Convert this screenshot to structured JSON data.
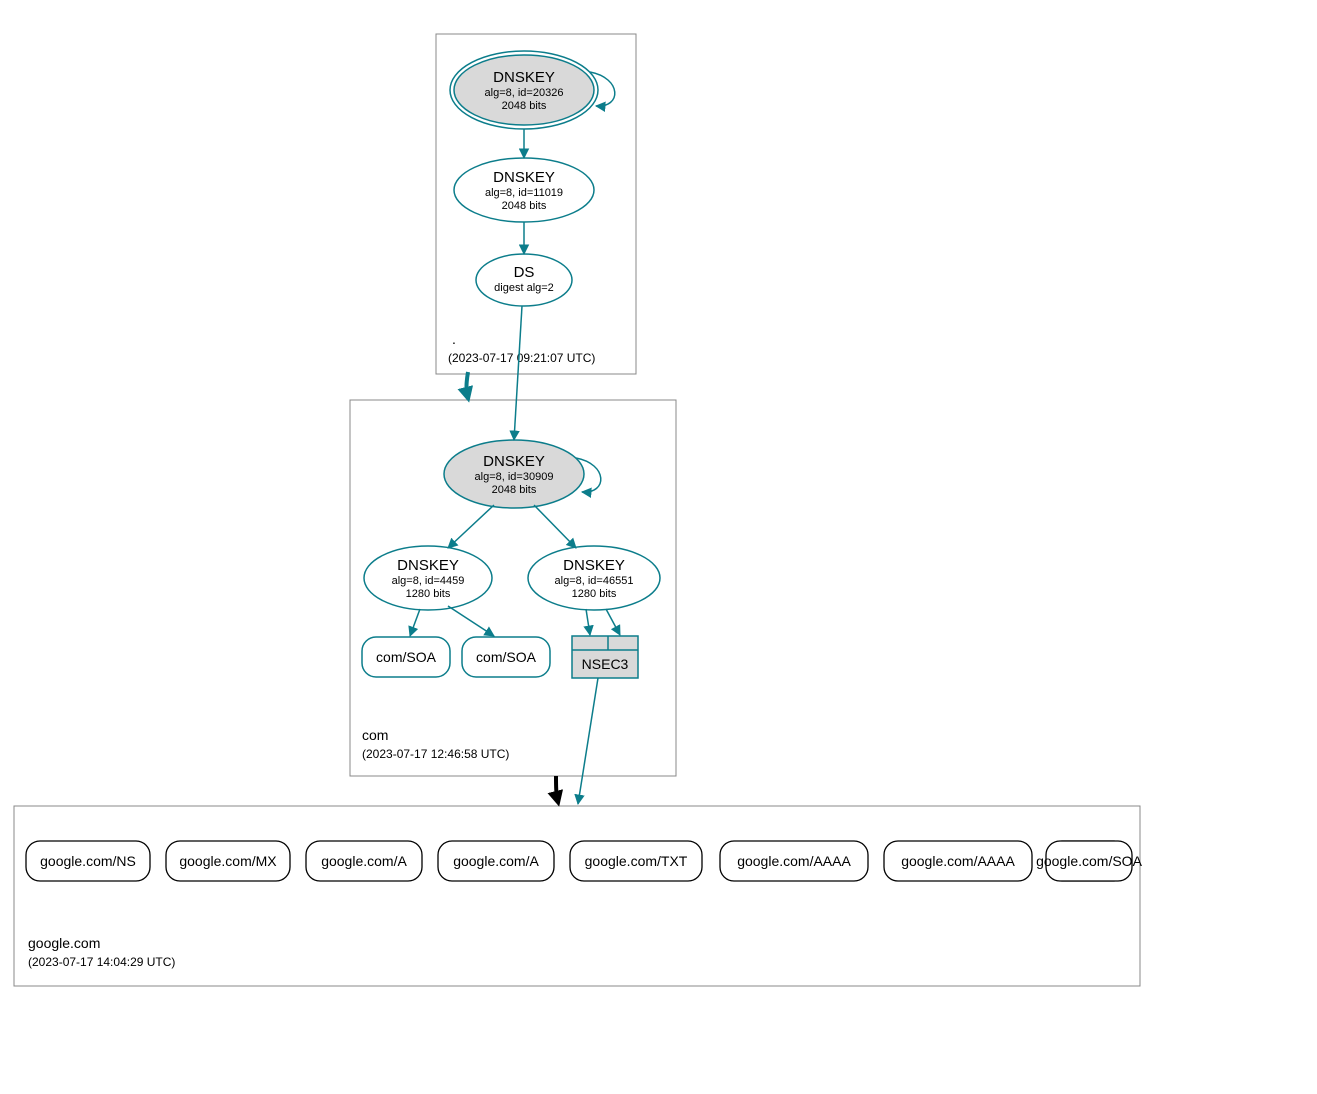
{
  "colors": {
    "teal": "#0c7d8b",
    "grey_fill": "#d9d9d9",
    "black": "#000000"
  },
  "zones": {
    "root": {
      "label": ".",
      "timestamp": "(2023-07-17 09:21:07 UTC)",
      "dnskey_ksk": {
        "title": "DNSKEY",
        "sub1": "alg=8, id=20326",
        "sub2": "2048 bits"
      },
      "dnskey_zsk": {
        "title": "DNSKEY",
        "sub1": "alg=8, id=11019",
        "sub2": "2048 bits"
      },
      "ds": {
        "title": "DS",
        "sub1": "digest alg=2"
      }
    },
    "com": {
      "label": "com",
      "timestamp": "(2023-07-17 12:46:58 UTC)",
      "dnskey_ksk": {
        "title": "DNSKEY",
        "sub1": "alg=8, id=30909",
        "sub2": "2048 bits"
      },
      "dnskey_zsk_a": {
        "title": "DNSKEY",
        "sub1": "alg=8, id=4459",
        "sub2": "1280 bits"
      },
      "dnskey_zsk_b": {
        "title": "DNSKEY",
        "sub1": "alg=8, id=46551",
        "sub2": "1280 bits"
      },
      "soa_a": {
        "label": "com/SOA"
      },
      "soa_b": {
        "label": "com/SOA"
      },
      "nsec3": {
        "label": "NSEC3"
      }
    },
    "google": {
      "label": "google.com",
      "timestamp": "(2023-07-17 14:04:29 UTC)",
      "records": [
        "google.com/NS",
        "google.com/MX",
        "google.com/A",
        "google.com/A",
        "google.com/TXT",
        "google.com/AAAA",
        "google.com/AAAA",
        "google.com/SOA"
      ]
    }
  }
}
